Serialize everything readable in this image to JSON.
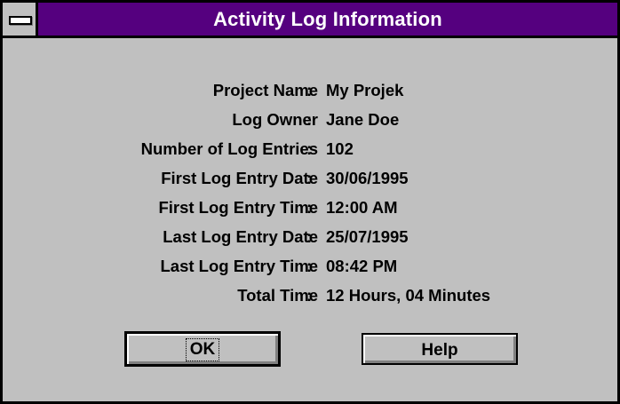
{
  "window": {
    "title": "Activity Log Information"
  },
  "info": {
    "rows": [
      {
        "label": "Project Name",
        "value": "My Projek"
      },
      {
        "label": "Log Owner",
        "value": "Jane Doe"
      },
      {
        "label": "Number of Log Entries",
        "value": "102"
      },
      {
        "label": "First Log Entry Date",
        "value": "30/06/1995"
      },
      {
        "label": "First Log Entry Time",
        "value": "12:00 AM"
      },
      {
        "label": "Last Log Entry Date",
        "value": "25/07/1995"
      },
      {
        "label": "Last Log Entry Time",
        "value": "08:42 PM"
      },
      {
        "label": "Total Time",
        "value": "12 Hours, 04 Minutes"
      }
    ],
    "separator": ":"
  },
  "buttons": {
    "ok_label": "OK",
    "help_label": "Help"
  },
  "colors": {
    "titlebar": "#55007f",
    "face": "#c0c0c0"
  },
  "icons": {
    "system_menu": "system-menu-icon"
  }
}
